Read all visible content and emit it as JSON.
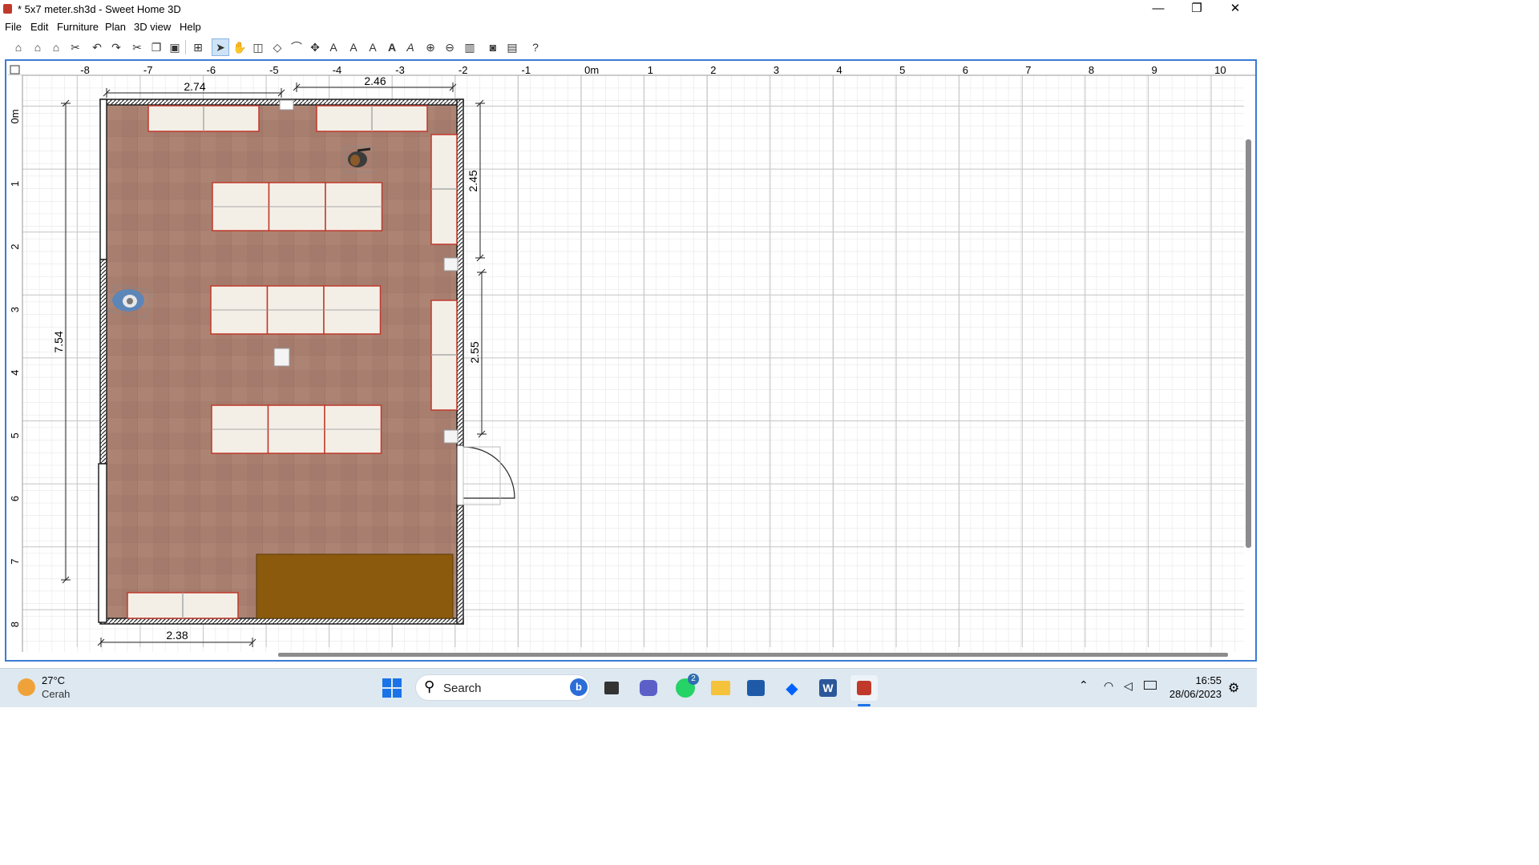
{
  "window": {
    "title": "* 5x7 meter.sh3d - Sweet Home 3D",
    "minimize": "—",
    "maximize": "❐",
    "close": "✕"
  },
  "menu": [
    "File",
    "Edit",
    "Furniture",
    "Plan",
    "3D view",
    "Help"
  ],
  "toolbar": [
    "new-home",
    "open",
    "save",
    "cut-furniture",
    "undo",
    "redo",
    "cut",
    "copy",
    "paste",
    "add-furniture",
    "select",
    "pan",
    "create-walls",
    "create-rooms",
    "create-polylines",
    "create-dimensions",
    "create-labels",
    "increase-text",
    "decrease-text",
    "bold-text",
    "italic-text",
    "zoom-in",
    "zoom-out",
    "create-3d-view",
    "create-photo",
    "create-video",
    "help"
  ],
  "plan": {
    "ruler_x": [
      "-8",
      "-7",
      "-6",
      "-5",
      "-4",
      "-3",
      "-2",
      "-1",
      "0m",
      "1",
      "2",
      "3",
      "4",
      "5",
      "6",
      "7",
      "8",
      "9",
      "10"
    ],
    "ruler_y": [
      "0m",
      "1",
      "2",
      "3",
      "4",
      "5",
      "6",
      "7",
      "8"
    ],
    "dimensions": {
      "top_left": "2.74",
      "top_right": "2.46",
      "right_upper": "2.45",
      "right_lower": "2.55",
      "left": "7.54",
      "bottom": "2.38"
    },
    "colors": {
      "floor": "#a87e6f",
      "wall": "#222222",
      "table_border": "#c0392b",
      "table_fill": "#f4efe6",
      "cabinet": "#8b5a0d",
      "grid": "#d0d0d0"
    }
  },
  "taskbar": {
    "weather_temp": "27°C",
    "weather_desc": "Cerah",
    "search_placeholder": "Search",
    "whatsapp_badge": "2",
    "time": "16:55",
    "date": "28/06/2023"
  }
}
